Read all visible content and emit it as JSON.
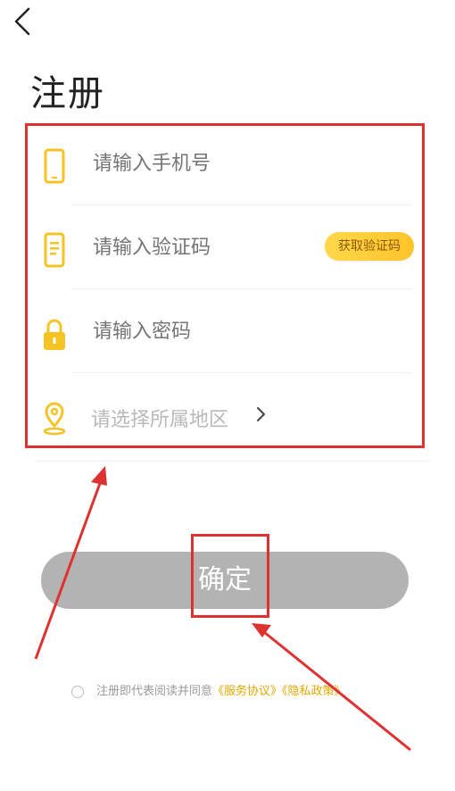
{
  "header": {
    "back_icon": "chevron-left-icon",
    "title": "注册"
  },
  "form": {
    "phone": {
      "placeholder": "请输入手机号",
      "icon": "phone-icon"
    },
    "code": {
      "placeholder": "请输入验证码",
      "icon": "message-phone-icon",
      "button": "获取验证码"
    },
    "password": {
      "placeholder": "请输入密码",
      "icon": "lock-icon"
    },
    "region": {
      "placeholder": "请选择所属地区",
      "icon": "location-pin-icon",
      "chevron": "chevron-right-icon"
    }
  },
  "confirm": {
    "label": "确定"
  },
  "agreement": {
    "prefix": "注册即代表阅读并同意",
    "service": "《服务协议》",
    "privacy": "《隐私政策》"
  },
  "colors": {
    "accent": "#FFD23F",
    "annotation": "#E03131",
    "button_disabled": "#B3B3B3"
  }
}
